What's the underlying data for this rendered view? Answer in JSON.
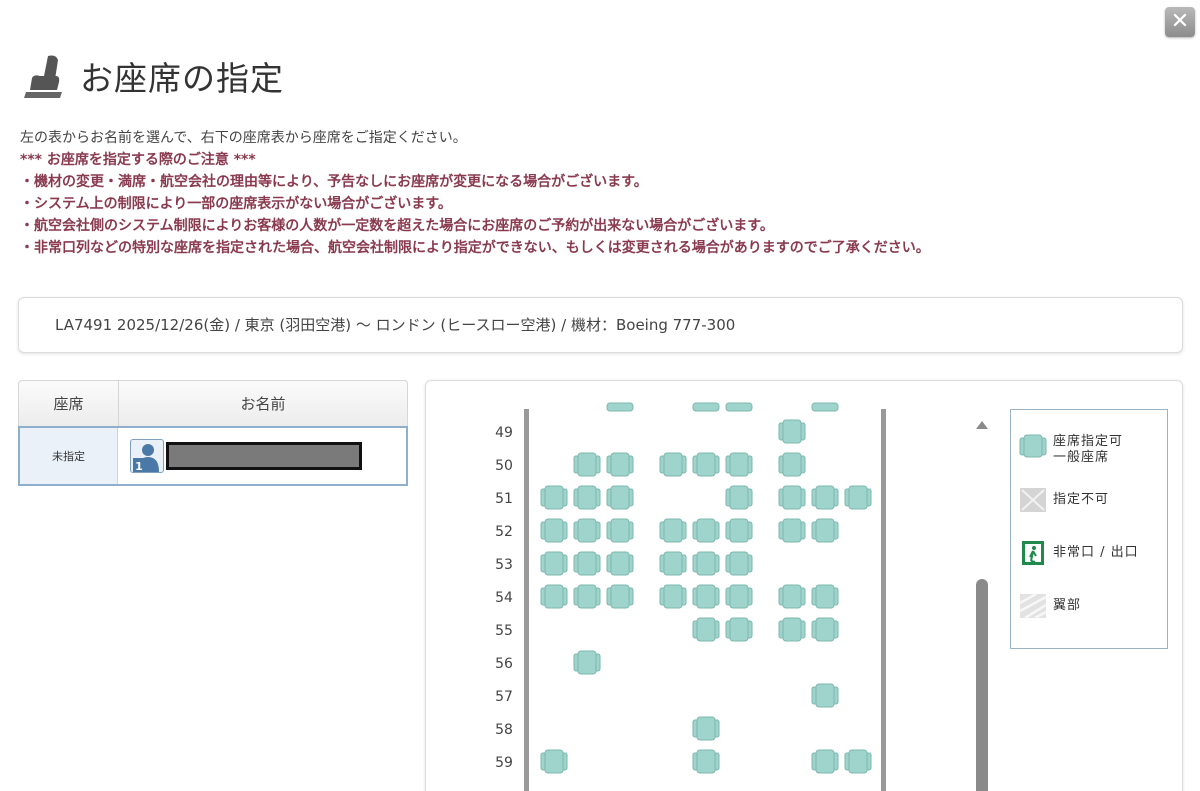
{
  "dialog": {
    "title": "お座席の指定",
    "close_label": "✕"
  },
  "intro": {
    "instruction": "左の表からお名前を選んで、右下の座席表から座席をご指定ください。",
    "notice_heading": "*** お座席を指定する際のご注意 ***",
    "notices": [
      "・機材の変更・満席・航空会社の理由等により、予告なしにお座席が変更になる場合がございます。",
      "・システム上の制限により一部の座席表示がない場合がございます。",
      "・航空会社側のシステム制限によりお客様の人数が一定数を超えた場合にお座席のご予約が出来ない場合がございます。",
      "・非常口列などの特別な座席を指定された場合、航空会社制限により指定ができない、もしくは変更される場合がありますのでご了承ください。"
    ]
  },
  "flight": {
    "summary": "LA7491 2025/12/26(金) / 東京 (羽田空港) ～ ロンドン (ヒースロー空港) / 機材：Boeing 777-300"
  },
  "passengers": {
    "col_seat": "座席",
    "col_name": "お名前",
    "rows": [
      {
        "seat": "未指定",
        "number": "1"
      }
    ]
  },
  "seat_map": {
    "seat_color": "#9fd4cc",
    "rows": [
      {
        "number": "49",
        "seats": [
          "H"
        ]
      },
      {
        "number": "50",
        "seats": [
          "B",
          "C",
          "D",
          "E",
          "F",
          "H"
        ]
      },
      {
        "number": "51",
        "seats": [
          "A",
          "B",
          "C",
          "F",
          "H",
          "J",
          "K"
        ]
      },
      {
        "number": "52",
        "seats": [
          "A",
          "B",
          "C",
          "D",
          "E",
          "F",
          "H",
          "J"
        ]
      },
      {
        "number": "53",
        "seats": [
          "A",
          "B",
          "C",
          "D",
          "E",
          "F"
        ]
      },
      {
        "number": "54",
        "seats": [
          "A",
          "B",
          "C",
          "D",
          "E",
          "F",
          "H",
          "J"
        ]
      },
      {
        "number": "55",
        "seats": [
          "E",
          "F",
          "H",
          "J"
        ]
      },
      {
        "number": "56",
        "seats": [
          "B"
        ]
      },
      {
        "number": "57",
        "seats": [
          "J"
        ]
      },
      {
        "number": "58",
        "seats": [
          "E"
        ]
      },
      {
        "number": "59",
        "seats": [
          "A",
          "E",
          "J",
          "K"
        ]
      }
    ]
  },
  "legend": {
    "available_line1": "座席指定可",
    "available_line2": "一般座席",
    "unavailable": "指定不可",
    "exit": "非常口 / 出口",
    "wing": "翼部"
  }
}
